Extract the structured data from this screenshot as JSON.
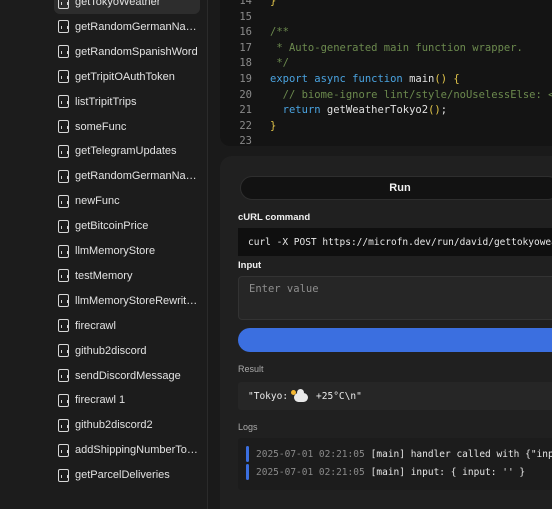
{
  "sidebar": {
    "items": [
      {
        "label": "getTokyoWeather",
        "active": true
      },
      {
        "label": "getRandomGermanNa…"
      },
      {
        "label": "getRandomSpanishWord"
      },
      {
        "label": "getTripitOAuthToken"
      },
      {
        "label": "listTripitTrips"
      },
      {
        "label": "someFunc"
      },
      {
        "label": "getTelegramUpdates"
      },
      {
        "label": "getRandomGermanNa…"
      },
      {
        "label": "newFunc"
      },
      {
        "label": "getBitcoinPrice"
      },
      {
        "label": "llmMemoryStore"
      },
      {
        "label": "testMemory"
      },
      {
        "label": "llmMemoryStoreRewritt…"
      },
      {
        "label": "firecrawl"
      },
      {
        "label": "github2discord"
      },
      {
        "label": "sendDiscordMessage"
      },
      {
        "label": "firecrawl 1"
      },
      {
        "label": "github2discord2"
      },
      {
        "label": "addShippingNumberTo…"
      },
      {
        "label": "getParcelDeliveries"
      }
    ]
  },
  "editor": {
    "lines": [
      {
        "n": "14",
        "text": "}"
      },
      {
        "n": "15",
        "text": ""
      },
      {
        "n": "16",
        "text": "/**"
      },
      {
        "n": "17",
        "text": " * Auto-generated main function wrapper."
      },
      {
        "n": "18",
        "text": " */"
      },
      {
        "n": "19",
        "text": "export async function main() {"
      },
      {
        "n": "20",
        "text": "  // biome-ignore lint/style/noUselessElse: <e"
      },
      {
        "n": "21",
        "text": "  return getWeatherTokyo2();"
      },
      {
        "n": "22",
        "text": "}"
      },
      {
        "n": "23",
        "text": ""
      }
    ],
    "line_kinds": [
      "yl",
      "plain",
      "cm",
      "cm",
      "cm",
      "fn",
      "cm",
      "ret",
      "yl",
      "plain"
    ]
  },
  "run_panel": {
    "run_label": "Run",
    "curl_label": "cURL command",
    "curl_command": "curl -X POST https://microfn.dev/run/david/gettokyoweather",
    "input_label": "Input",
    "input_placeholder": "Enter value",
    "result_label": "Result",
    "result_prefix": "\"Tokyo:",
    "result_suffix": "+25°C\\n\"",
    "logs_label": "Logs",
    "logs": [
      {
        "timestamp": "2025-07-01 02:21:05",
        "message": "[main] handler called with {\"input\":"
      },
      {
        "timestamp": "2025-07-01 02:21:05",
        "message": "[main] input: { input: '' }"
      }
    ]
  },
  "colors": {
    "accent": "#3b6fe0",
    "comment": "#6c8a4e",
    "keyword": "#4aa3e0",
    "bracket": "#e3c64a"
  }
}
